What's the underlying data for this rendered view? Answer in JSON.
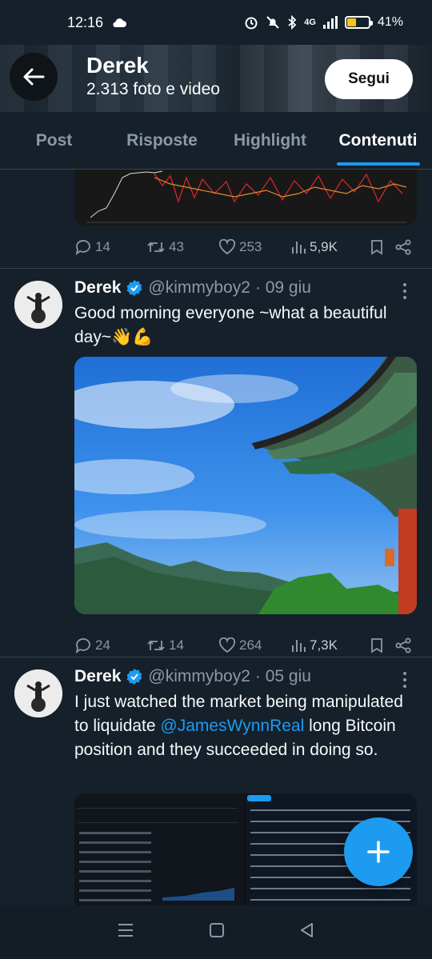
{
  "status_bar": {
    "time": "12:16",
    "battery": "41%",
    "network": "4G"
  },
  "header": {
    "name": "Derek",
    "subtitle": "2.313 foto e video",
    "follow_label": "Segui"
  },
  "tabs": [
    {
      "label": "Post",
      "active": false
    },
    {
      "label": "Risposte",
      "active": false
    },
    {
      "label": "Highlight",
      "active": false
    },
    {
      "label": "Contenuti",
      "active": true
    }
  ],
  "posts": [
    {
      "stats": {
        "replies": "14",
        "reposts": "43",
        "likes": "253",
        "views": "5,9K"
      }
    },
    {
      "name": "Derek",
      "handle": "@kimmyboy2",
      "date": "· 09 giu",
      "text": "Good morning everyone ~what a beautiful day~👋💪",
      "stats": {
        "replies": "24",
        "reposts": "14",
        "likes": "264",
        "views": "7,3K"
      }
    },
    {
      "name": "Derek",
      "handle": "@kimmyboy2",
      "date": "· 05 giu",
      "text_before": "I just watched the market being manipulated to liquidate ",
      "mention": "@JamesWynnReal",
      "text_after": " long Bitcoin position and they succeeded in doing so."
    }
  ],
  "colors": {
    "accent": "#1d9bf0",
    "background": "#15202b",
    "muted": "#8b98a5"
  }
}
